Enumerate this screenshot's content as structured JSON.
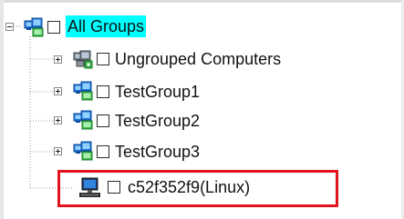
{
  "tree": {
    "root": {
      "label": "All Groups",
      "icon": "group-icon",
      "expanded": true,
      "selected": true,
      "checked": false
    },
    "children": [
      {
        "label": "Ungrouped Computers",
        "icon": "ungrouped-computers-icon",
        "expanded": false,
        "checked": false
      },
      {
        "label": "TestGroup1",
        "icon": "group-icon",
        "expanded": false,
        "checked": false
      },
      {
        "label": "TestGroup2",
        "icon": "group-icon",
        "expanded": false,
        "checked": false
      },
      {
        "label": "TestGroup3",
        "icon": "group-icon",
        "expanded": false,
        "checked": false
      },
      {
        "label": "c52f352f9(Linux)",
        "icon": "linux-computer-icon",
        "checked": false,
        "highlighted": true
      }
    ]
  },
  "colors": {
    "selection": "#00ffff",
    "highlight_border": "#e3131b",
    "group_icon_blue": "#1e73d8",
    "group_icon_green": "#3cb94a"
  }
}
